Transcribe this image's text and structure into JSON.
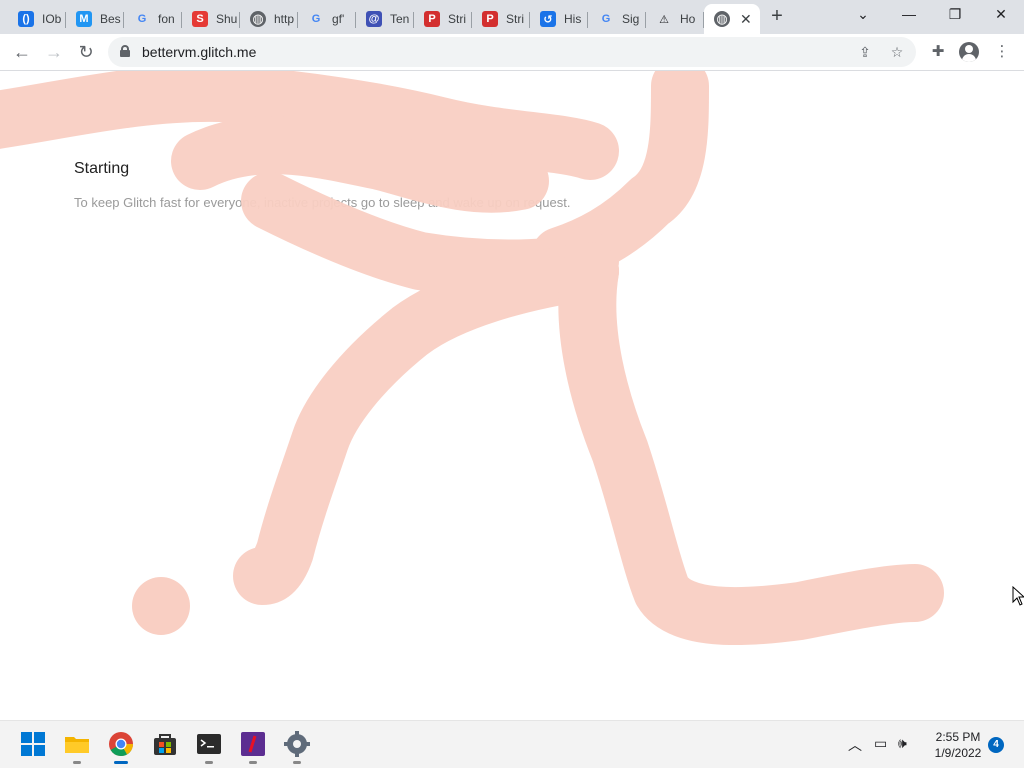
{
  "browser": {
    "tabs": [
      {
        "title": "IOb",
        "icon": "iobit-icon",
        "color": "#1a73e8",
        "glyph": "()"
      },
      {
        "title": "Bes",
        "icon": "bestbuy-icon",
        "color": "#2196f3",
        "glyph": "M"
      },
      {
        "title": "fon",
        "icon": "google-icon",
        "color": "#ffffff",
        "glyph": "G"
      },
      {
        "title": "Shu",
        "icon": "shutterstock-icon",
        "color": "#e53935",
        "glyph": "S"
      },
      {
        "title": "http",
        "icon": "globe-icon",
        "color": "#5f6368",
        "glyph": "◍"
      },
      {
        "title": "gf'",
        "icon": "google-icon",
        "color": "#ffffff",
        "glyph": "G"
      },
      {
        "title": "Ten",
        "icon": "at-icon",
        "color": "#3f51b5",
        "glyph": "@"
      },
      {
        "title": "Stri",
        "icon": "stripchat-icon",
        "color": "#d32f2f",
        "glyph": "P"
      },
      {
        "title": "Stri",
        "icon": "stripchat-icon",
        "color": "#d32f2f",
        "glyph": "P"
      },
      {
        "title": "His",
        "icon": "history-icon",
        "color": "#1a73e8",
        "glyph": "↺"
      },
      {
        "title": "Sig",
        "icon": "google-icon",
        "color": "#ffffff",
        "glyph": "G"
      },
      {
        "title": "Ho",
        "icon": "warning-icon",
        "color": "#202124",
        "glyph": "⚠"
      },
      {
        "title": "",
        "icon": "globe-icon",
        "color": "#5f6368",
        "glyph": "◍",
        "active": true
      }
    ],
    "new_tab_label": "+",
    "url": "bettervm.glitch.me"
  },
  "page": {
    "heading": "Starting",
    "subtext": "To keep Glitch fast for everyone, inactive projects go to sleep and wake up on request.",
    "stroke_color": "#f9cfc3"
  },
  "taskbar": {
    "time": "2:55 PM",
    "date": "1/9/2022",
    "notification_count": "4"
  }
}
